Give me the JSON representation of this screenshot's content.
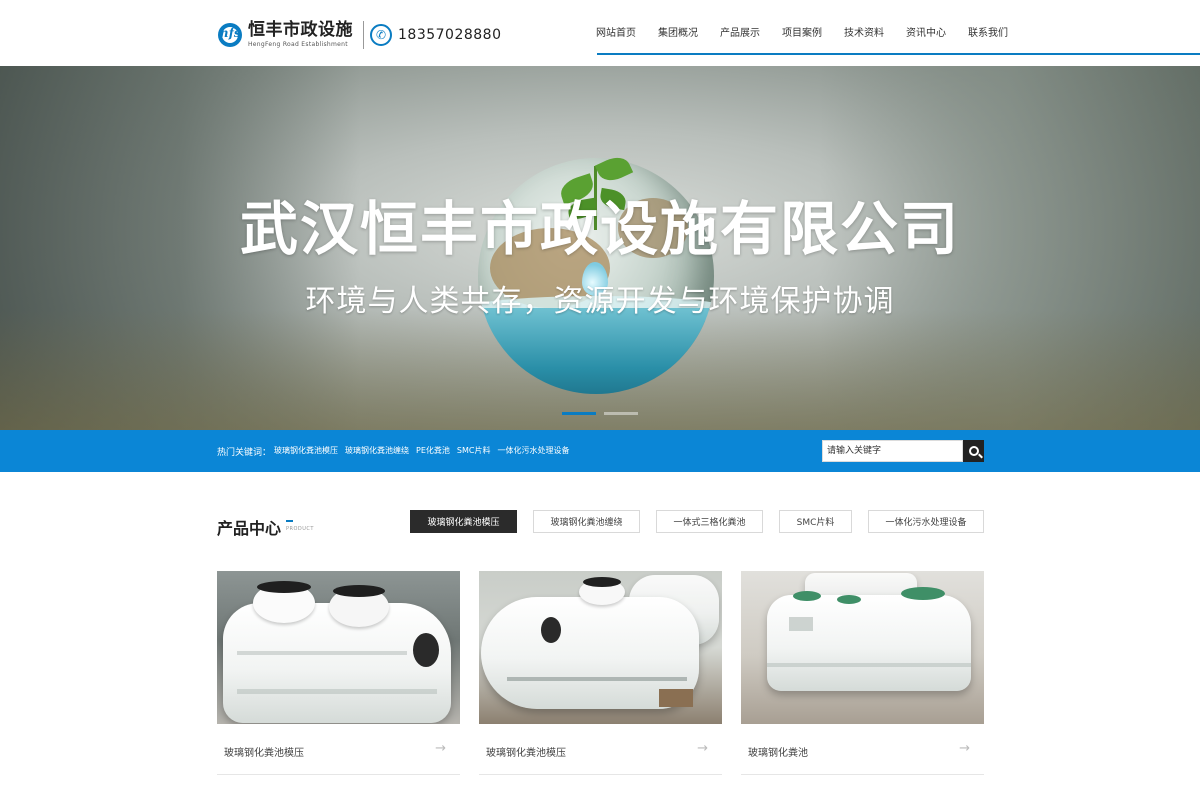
{
  "header": {
    "logo_name": "恒丰市政设施",
    "logo_en": "HengFeng Road Establishment",
    "logo_letters": "hfs",
    "phone": "18357028880",
    "nav": [
      "网站首页",
      "集团概况",
      "产品展示",
      "项目案例",
      "技术资料",
      "资讯中心",
      "联系我们"
    ]
  },
  "banner": {
    "title": "武汉恒丰市政设施有限公司",
    "subtitle": "环境与人类共存，资源开发与环境保护协调",
    "slides": 2,
    "active_slide": 1
  },
  "keywords": {
    "label": "热门关键词：",
    "items": [
      "玻璃钢化粪池模压",
      "玻璃钢化粪池缠绕",
      "PE化粪池",
      "SMC片料",
      "一体化污水处理设备"
    ],
    "search_placeholder": "请输入关键字"
  },
  "products": {
    "title": "产品中心",
    "title_en": "PRODUCT",
    "tabs": [
      "玻璃钢化粪池模压",
      "玻璃钢化粪池缠绕",
      "一体式三格化粪池",
      "SMC片料",
      "一体化污水处理设备"
    ],
    "active_tab": 0,
    "cards": [
      {
        "caption": "玻璃钢化粪池模压",
        "arrow": "→"
      },
      {
        "caption": "玻璃钢化粪池模压",
        "arrow": "→"
      },
      {
        "caption": "玻璃钢化粪池",
        "arrow": "→"
      }
    ]
  },
  "colors": {
    "accent": "#0a7cc2",
    "keyword_bar": "#0b86d6",
    "active_tab": "#2b2b2b"
  }
}
